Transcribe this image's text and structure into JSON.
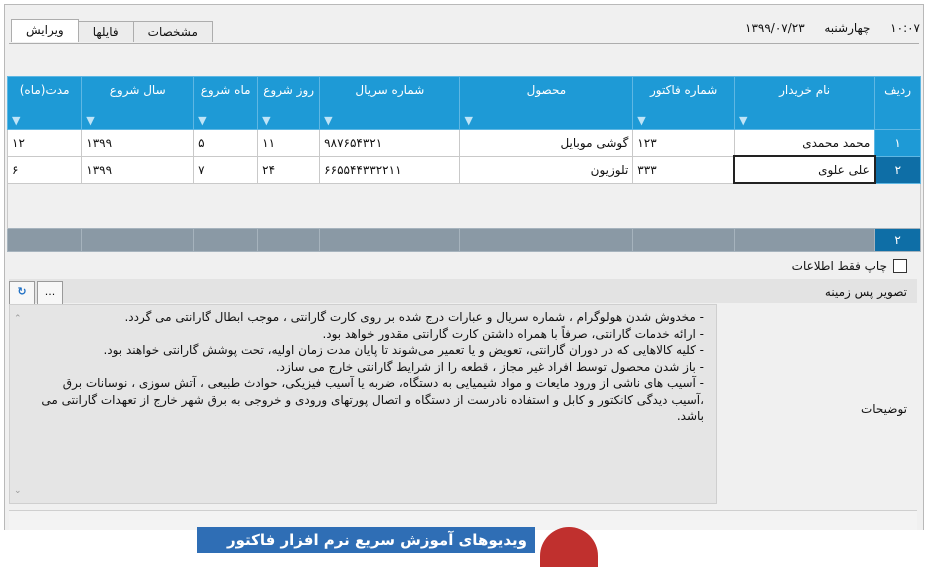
{
  "tabs": [
    "ویرایش",
    "فایلها",
    "مشخصات"
  ],
  "header": {
    "day": "چهارشنبه",
    "date": "۱۳۹۹/۰۷/۲۳",
    "time": "۱۰:۰۷"
  },
  "columns": [
    "ردیف",
    "نام خریدار",
    "شماره فاکتور",
    "محصول",
    "شماره سریال",
    "روز شروع",
    "ماه شروع",
    "سال شروع",
    "مدت(ماه)"
  ],
  "rows": [
    {
      "index": "۱",
      "buyer": "محمد محمدی",
      "invoice": "۱۲۳",
      "product": "گوشی موبایل",
      "serial": "۹۸۷۶۵۴۳۲۱",
      "day": "۱۱",
      "month": "۵",
      "year": "۱۳۹۹",
      "duration": "۱۲"
    },
    {
      "index": "۲",
      "buyer": "علی علوی",
      "invoice": "۳۳۳",
      "product": "تلوزیون",
      "serial": "۶۶۵۵۴۴۳۳۲۲۱۱",
      "day": "۲۴",
      "month": "۷",
      "year": "۱۳۹۹",
      "duration": "۶"
    }
  ],
  "footer": {
    "count": "۲"
  },
  "form": {
    "print_only_label": "چاپ فقط اطلاعات",
    "background_image_label": "تصویر پس زمینه",
    "browse_label": "...",
    "refresh_icon": "refresh-icon",
    "description_label": "توضیحات",
    "description_lines": [
      "- مخدوش شدن هولوگرام ، شماره سریال و عبارات درج شده بر روی کارت گارانتی ، موجب ابطال گارانتی می گردد.",
      "- ارائه خدمات گارانتی، صرفاً با همراه داشتن کارت گارانتی مقدور خواهد بود.",
      "- کلیه کالاهایی که در دوران گارانتی، تعویض و یا تعمیر می‌شوند تا پایان مدت زمان اولیه، تحت پوشش گارانتی خواهند بود.",
      "- باز شدن محصول توسط افراد غیر مجاز ، قطعه را از شرایط گارانتی خارج می سازد.",
      "- آسیب های ناشی از ورود مایعات و مواد شیمیایی به دستگاه، ضربه یا آسیب فیزیکی، حوادث طبیعی ، آتش سوزی ، نوسانات برق",
      "،آسیب دیدگی کانکتور و کابل و استفاده نادرست از دستگاه و اتصال پورتهای ورودی و خروجی به برق شهر خارج از تعهدات گارانتی می",
      "باشد."
    ]
  },
  "banner": {
    "text": "ویدیوهای آموزش سریع نرم افزار فاکتور"
  },
  "colors": {
    "header_blue": "#1e9ad6",
    "footer_gray": "#8a99a5",
    "banner_blue": "#2f6eb5"
  }
}
